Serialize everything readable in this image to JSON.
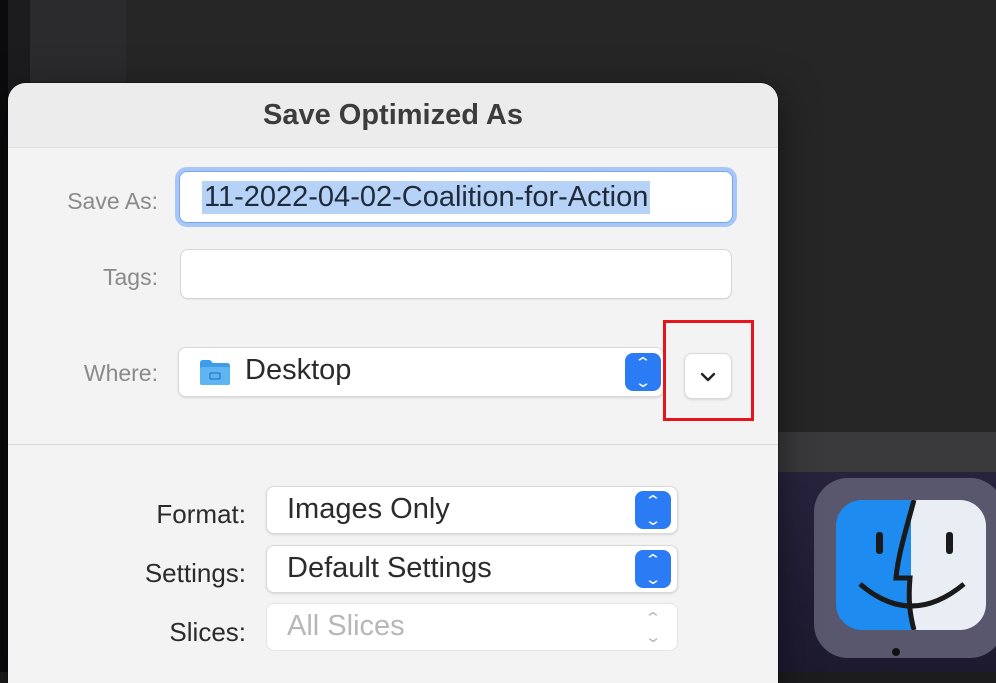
{
  "dialog": {
    "title": "Save Optimized As",
    "save_as_label": "Save As:",
    "save_as_value": "11-2022-04-02-Coalition-for-Action",
    "tags_label": "Tags:",
    "tags_value": "",
    "where_label": "Where:",
    "where_value": "Desktop",
    "where_icon": "folder-icon",
    "format_label": "Format:",
    "format_value": "Images Only",
    "settings_label": "Settings:",
    "settings_value": "Default Settings",
    "slices_label": "Slices:",
    "slices_value": "All Slices",
    "expand_icon": "chevron-down-icon"
  },
  "dock": {
    "apps": [
      {
        "name": "Finder",
        "icon": "finder-icon"
      }
    ]
  },
  "colors": {
    "accent": "#2b7cf4",
    "highlight": "#e5141d",
    "selection": "#b6d2f7"
  }
}
